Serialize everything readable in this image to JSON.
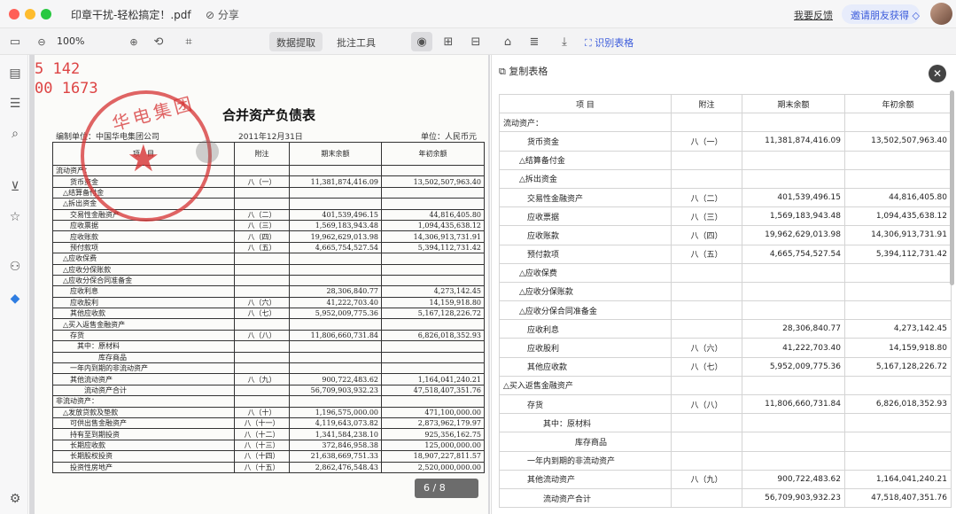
{
  "titlebar": {
    "file_name": "印章干扰-轻松搞定！.pdf",
    "share_label": "分享",
    "feedback_label": "我要反馈",
    "invite_label": "邀请朋友获得"
  },
  "toolbar": {
    "zoom_value": "100%",
    "tab_extract": "数据提取",
    "tab_annotate": "批注工具",
    "recognize_label": "识别表格"
  },
  "document": {
    "handwritten_top": "5  142",
    "handwritten_bottom": "00  1673",
    "title": "合并资产负债表",
    "company": "编制单位：中国华电集团公司",
    "date": "2011年12月31日",
    "unit": "单位：人民币元",
    "page_indicator": "6 / 8",
    "headers": [
      "项　目",
      "附注",
      "期末余额",
      "年初余额"
    ],
    "rows": [
      [
        "流动资产：",
        "",
        "",
        ""
      ],
      [
        "　　货币资金",
        "八（一）",
        "11,381,874,416.09",
        "13,502,507,963.40"
      ],
      [
        "　△结算备付金",
        "",
        "",
        ""
      ],
      [
        "　△拆出资金",
        "",
        "",
        ""
      ],
      [
        "　　交易性金融资产",
        "八（二）",
        "401,539,496.15",
        "44,816,405.80"
      ],
      [
        "　　应收票据",
        "八（三）",
        "1,569,183,943.48",
        "1,094,435,638.12"
      ],
      [
        "　　应收账款",
        "八（四）",
        "19,962,629,013.98",
        "14,306,913,731.91"
      ],
      [
        "　　预付款项",
        "八（五）",
        "4,665,754,527.54",
        "5,394,112,731.42"
      ],
      [
        "　△应收保费",
        "",
        "",
        ""
      ],
      [
        "　△应收分保账款",
        "",
        "",
        ""
      ],
      [
        "　△应收分保合同准备金",
        "",
        "",
        ""
      ],
      [
        "　　应收利息",
        "",
        "28,306,840.77",
        "4,273,142.45"
      ],
      [
        "　　应收股利",
        "八（六）",
        "41,222,703.40",
        "14,159,918.80"
      ],
      [
        "　　其他应收款",
        "八（七）",
        "5,952,009,775.36",
        "5,167,128,226.72"
      ],
      [
        "　△买入返售金融资产",
        "",
        "",
        ""
      ],
      [
        "　　存货",
        "八（八）",
        "11,806,660,731.84",
        "6,826,018,352.93"
      ],
      [
        "　　　其中：原材料",
        "",
        "",
        ""
      ],
      [
        "　　　　　　库存商品",
        "",
        "",
        ""
      ],
      [
        "　　一年内到期的非流动资产",
        "",
        "",
        ""
      ],
      [
        "　　其他流动资产",
        "八（九）",
        "900,722,483.62",
        "1,164,041,240.21"
      ],
      [
        "　　　　流动资产合计",
        "",
        "56,709,903,932.23",
        "47,518,407,351.76"
      ],
      [
        "非流动资产：",
        "",
        "",
        ""
      ],
      [
        "　△发放贷款及垫款",
        "八（十）",
        "1,196,575,000.00",
        "471,100,000.00"
      ],
      [
        "　　可供出售金融资产",
        "八（十一）",
        "4,119,643,073.82",
        "2,873,962,179.97"
      ],
      [
        "　　持有至到期投资",
        "八（十二）",
        "1,341,584,238.10",
        "925,356,162.75"
      ],
      [
        "　　长期应收款",
        "八（十三）",
        "372,846,958.38",
        "125,000,000.00"
      ],
      [
        "　　长期股权投资",
        "八（十四）",
        "21,638,669,751.33",
        "18,907,227,811.57"
      ],
      [
        "　　投资性房地产",
        "八（十五）",
        "2,862,476,548.43",
        "2,520,000,000.00"
      ]
    ]
  },
  "result": {
    "copy_label": "复制表格",
    "headers": [
      "项 目",
      "附注",
      "期末余额",
      "年初余额"
    ],
    "rows": [
      [
        "流动资产：",
        "",
        "",
        ""
      ],
      [
        "　　　货币资金",
        "八（一）",
        "11,381,874,416.09",
        "13,502,507,963.40"
      ],
      [
        "　　△结算备付金",
        "",
        "",
        ""
      ],
      [
        "　　△拆出资金",
        "",
        "",
        ""
      ],
      [
        "　　　交易性金融资产",
        "八（二）",
        "401,539,496.15",
        "44,816,405.80"
      ],
      [
        "　　　应收票据",
        "八（三）",
        "1,569,183,943.48",
        "1,094,435,638.12"
      ],
      [
        "　　　应收账款",
        "八（四）",
        "19,962,629,013.98",
        "14,306,913,731.91"
      ],
      [
        "　　　预付款项",
        "八（五）",
        "4,665,754,527.54",
        "5,394,112,731.42"
      ],
      [
        "　　△应收保费",
        "",
        "",
        ""
      ],
      [
        "　　△应收分保账款",
        "",
        "",
        ""
      ],
      [
        "　　△应收分保合同准备金",
        "",
        "",
        ""
      ],
      [
        "　　　应收利息",
        "",
        "28,306,840.77",
        "4,273,142.45"
      ],
      [
        "　　　应收股利",
        "八（六）",
        "41,222,703.40",
        "14,159,918.80"
      ],
      [
        "　　　其他应收款",
        "八（七）",
        "5,952,009,775.36",
        "5,167,128,226.72"
      ],
      [
        "△买入返售金融资产",
        "",
        "",
        ""
      ],
      [
        "　　　存货",
        "八（八）",
        "11,806,660,731.84",
        "6,826,018,352.93"
      ],
      [
        "　　　　　其中：原材料",
        "",
        "",
        ""
      ],
      [
        "　　　　　　　　　库存商品",
        "",
        "",
        ""
      ],
      [
        "　　　一年内到期的非流动资产",
        "",
        "",
        ""
      ],
      [
        "　　　其他流动资产",
        "八（九）",
        "900,722,483.62",
        "1,164,041,240.21"
      ],
      [
        "　　　　　流动资产合计",
        "",
        "56,709,903,932.23",
        "47,518,407,351.76"
      ]
    ]
  },
  "icons": {
    "folder": "folder-icon",
    "search": "search-icon",
    "settings": "gear-icon",
    "eye": "eye-icon",
    "close": "close-icon"
  }
}
